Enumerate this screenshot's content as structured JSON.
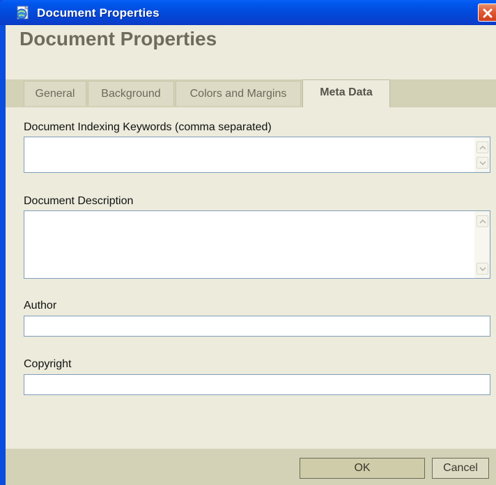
{
  "window": {
    "title": "Document Properties",
    "app_icon": "globe-document-icon",
    "close_icon": "close-icon",
    "colors": {
      "titlebar": "#0347d6",
      "close": "#e05a35",
      "client": "#ecebdc",
      "tabs_bar": "#d3d1b6"
    }
  },
  "dialog": {
    "heading": "Document Properties",
    "tabs": [
      {
        "label": "General",
        "active": false
      },
      {
        "label": "Background",
        "active": false
      },
      {
        "label": "Colors and Margins",
        "active": false
      },
      {
        "label": "Meta Data",
        "active": true
      }
    ]
  },
  "form": {
    "keywords": {
      "label": "Document Indexing Keywords (comma separated)",
      "value": ""
    },
    "description": {
      "label": "Document Description",
      "value": ""
    },
    "author": {
      "label": "Author",
      "value": ""
    },
    "copyright": {
      "label": "Copyright",
      "value": ""
    },
    "scroll_up_icon": "scroll-up-arrow-icon",
    "scroll_down_icon": "scroll-down-arrow-icon"
  },
  "footer": {
    "ok_label": "OK",
    "cancel_label": "Cancel"
  }
}
